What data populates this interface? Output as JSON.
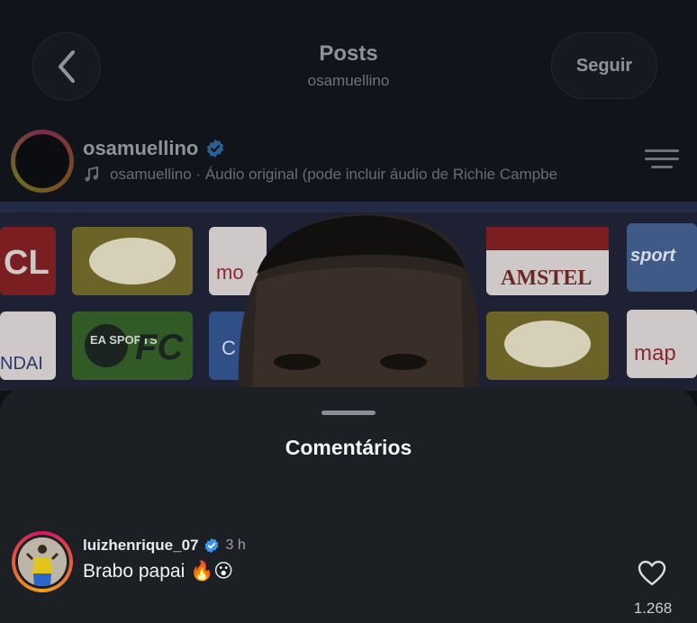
{
  "header": {
    "title": "Posts",
    "subtitle": "osamuellino",
    "follow_label": "Seguir"
  },
  "post": {
    "username": "osamuellino",
    "audio_text": "osamuellino · Áudio original  (pode incluir áudio de Richie Campbe",
    "media_signs": [
      "CL",
      "AMSTEL",
      "sport",
      "EA SPORTS",
      "FC",
      "mo",
      "map",
      "C",
      "NDAI"
    ]
  },
  "comments_sheet": {
    "title": "Comentários",
    "comments": [
      {
        "username": "luizhenrique_07",
        "time": "3 h",
        "text": "Brabo papai 🔥😮",
        "likes": "1.268"
      }
    ]
  }
}
